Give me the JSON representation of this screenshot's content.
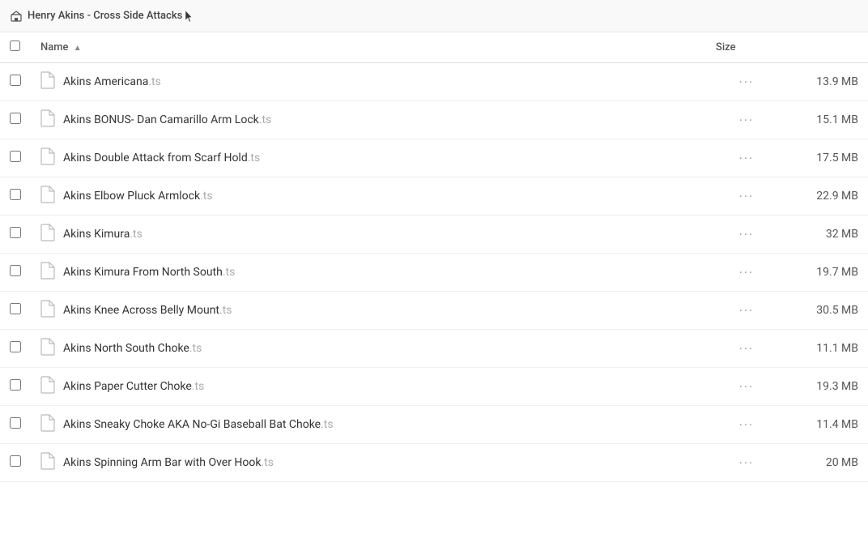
{
  "breadcrumb": {
    "home_label": "Henry Akins - Cross Side Attacks",
    "cursor": true
  },
  "table": {
    "col_name": "Name",
    "col_size": "Size",
    "sort_direction": "asc",
    "files": [
      {
        "id": 1,
        "name_base": "Akins Americana",
        "ext": ".ts",
        "size": "13.9 MB"
      },
      {
        "id": 2,
        "name_base": "Akins BONUS- Dan Camarillo Arm Lock",
        "ext": ".ts",
        "size": "15.1 MB"
      },
      {
        "id": 3,
        "name_base": "Akins Double Attack from Scarf Hold",
        "ext": ".ts",
        "size": "17.5 MB"
      },
      {
        "id": 4,
        "name_base": "Akins Elbow Pluck Armlock",
        "ext": ".ts",
        "size": "22.9 MB"
      },
      {
        "id": 5,
        "name_base": "Akins Kimura",
        "ext": ".ts",
        "size": "32 MB"
      },
      {
        "id": 6,
        "name_base": "Akins Kimura From North South",
        "ext": ".ts",
        "size": "19.7 MB"
      },
      {
        "id": 7,
        "name_base": "Akins Knee Across Belly Mount",
        "ext": ".ts",
        "size": "30.5 MB"
      },
      {
        "id": 8,
        "name_base": "Akins North South Choke",
        "ext": ".ts",
        "size": "11.1 MB"
      },
      {
        "id": 9,
        "name_base": "Akins Paper Cutter Choke",
        "ext": ".ts",
        "size": "19.3 MB"
      },
      {
        "id": 10,
        "name_base": "Akins Sneaky Choke AKA No-Gi Baseball Bat Choke",
        "ext": ".ts",
        "size": "11.4 MB"
      },
      {
        "id": 11,
        "name_base": "Akins Spinning Arm Bar with Over Hook",
        "ext": ".ts",
        "size": "20 MB"
      }
    ]
  }
}
